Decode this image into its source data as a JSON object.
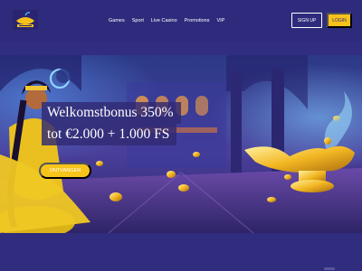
{
  "header": {
    "logo_icon": "genie-lamp-logo",
    "nav": [
      "Games",
      "Sport",
      "Live Casino",
      "Promotions",
      "VIP"
    ],
    "signup_label": "SIGN UP",
    "login_label": "LOGIN"
  },
  "hero": {
    "line1": "Welkomstbonus 350%",
    "line2": "tot €2.000 + 1.000 FS",
    "cta_label": "ONTVANGEN"
  },
  "colors": {
    "header_bg": "#2f2b7c",
    "accent_yellow": "#f6c21a",
    "text": "#ffffff"
  }
}
